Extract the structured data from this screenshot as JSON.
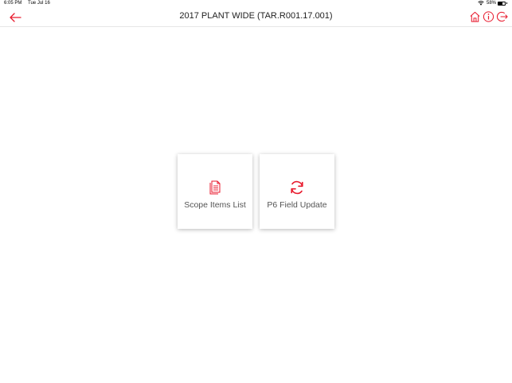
{
  "status_bar": {
    "time": "6:05 PM",
    "date": "Tue Jul 16",
    "battery_percent": "58%",
    "battery_level": 0.58
  },
  "nav": {
    "title": "2017 PLANT WIDE (TAR.R001.17.001)",
    "back_icon": "arrow-left-icon",
    "actions": [
      "home-icon",
      "info-icon",
      "logout-icon"
    ]
  },
  "tiles": [
    {
      "label": "Scope Items List",
      "icon": "document-list-icon"
    },
    {
      "label": "P6 Field Update",
      "icon": "refresh-icon"
    }
  ],
  "colors": {
    "accent": "#e8192c",
    "title_text": "#222222",
    "tile_label": "#555555"
  }
}
